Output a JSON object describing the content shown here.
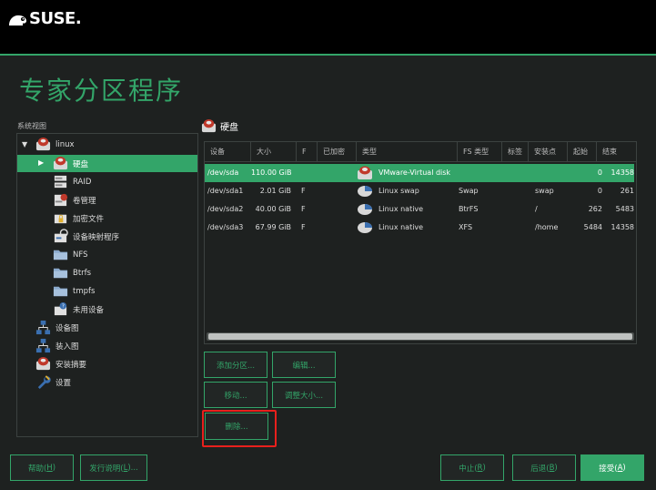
{
  "brand": {
    "logo_text": "SUSE."
  },
  "page": {
    "title": "专家分区程序"
  },
  "system_view": {
    "label": "系统视图",
    "items": [
      {
        "label": "linux",
        "icon": "hard-disk-icon"
      },
      {
        "label": "硬盘",
        "icon": "hard-disk-icon"
      },
      {
        "label": "RAID",
        "icon": "raid-icon"
      },
      {
        "label": "卷管理",
        "icon": "volume-manager-icon"
      },
      {
        "label": "加密文件",
        "icon": "encrypted-file-icon"
      },
      {
        "label": "设备映射程序",
        "icon": "device-mapper-icon"
      },
      {
        "label": "NFS",
        "icon": "folder-icon"
      },
      {
        "label": "Btrfs",
        "icon": "folder-icon"
      },
      {
        "label": "tmpfs",
        "icon": "folder-icon"
      },
      {
        "label": "未用设备",
        "icon": "unused-device-icon"
      },
      {
        "label": "设备图",
        "icon": "device-graph-icon"
      },
      {
        "label": "装入图",
        "icon": "mount-graph-icon"
      },
      {
        "label": "安装摘要",
        "icon": "hard-disk-icon"
      },
      {
        "label": "设置",
        "icon": "wrench-icon"
      }
    ]
  },
  "disks": {
    "title": "硬盘",
    "columns": [
      "设备",
      "大小",
      "F",
      "已加密",
      "类型",
      "FS 类型",
      "标签",
      "安装点",
      "起始",
      "结束"
    ],
    "rows": [
      {
        "device": "/dev/sda",
        "size": "110.00 GiB",
        "f": "",
        "enc": "",
        "type": "VMware-Virtual disk",
        "fstype": "",
        "label": "",
        "mount": "",
        "start": "0",
        "end": "14358",
        "icon": "hard-disk-icon"
      },
      {
        "device": "/dev/sda1",
        "size": "2.01 GiB",
        "f": "F",
        "enc": "",
        "type": "Linux swap",
        "fstype": "Swap",
        "label": "",
        "mount": "swap",
        "start": "0",
        "end": "261",
        "icon": "partition-icon"
      },
      {
        "device": "/dev/sda2",
        "size": "40.00 GiB",
        "f": "F",
        "enc": "",
        "type": "Linux native",
        "fstype": "BtrFS",
        "label": "",
        "mount": "/",
        "start": "262",
        "end": "5483",
        "icon": "partition-icon"
      },
      {
        "device": "/dev/sda3",
        "size": "67.99 GiB",
        "f": "F",
        "enc": "",
        "type": "Linux native",
        "fstype": "XFS",
        "label": "",
        "mount": "/home",
        "start": "5484",
        "end": "14358",
        "icon": "partition-icon"
      }
    ]
  },
  "actions": {
    "add_partition": "添加分区...",
    "edit": "编辑...",
    "move": "移动...",
    "resize": "调整大小...",
    "delete": "删除..."
  },
  "footer": {
    "help": "帮助(",
    "help_key": "H",
    "release_notes": "发行说明(",
    "release_notes_key": "L",
    "release_notes_suffix": ")...",
    "abort": "中止(",
    "abort_key": "R",
    "back": "后退(",
    "back_key": "B",
    "accept": "接受(",
    "accept_key": "A",
    "close_paren": ")"
  },
  "colors": {
    "accent": "#33a569",
    "background": "#1e2120",
    "highlight": "#e8201c"
  }
}
